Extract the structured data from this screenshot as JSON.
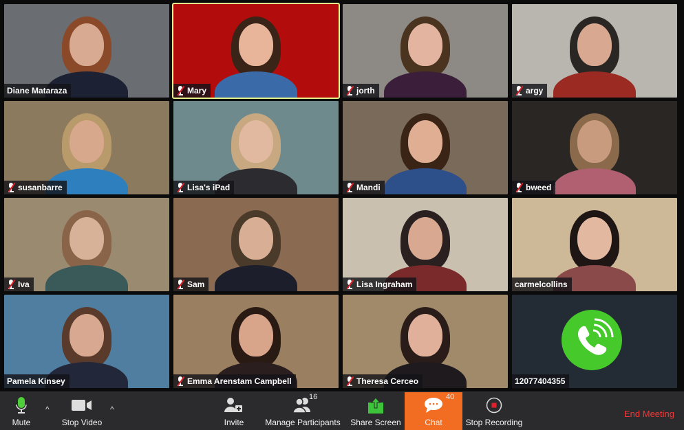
{
  "participants": [
    {
      "name": "Diane Mataraza",
      "muted": false,
      "active": false,
      "bg": "#6a6e72",
      "skin": "#d8aa92",
      "hair": "#8a4a2a",
      "shirt": "#1c2233"
    },
    {
      "name": "Mary",
      "muted": true,
      "active": true,
      "bg": "#b30c0c",
      "skin": "#e8b49a",
      "hair": "#3a2418",
      "shirt": "#3a6aa8"
    },
    {
      "name": "jorth",
      "muted": true,
      "active": false,
      "bg": "#8d8a85",
      "skin": "#e3b4a0",
      "hair": "#4a3420",
      "shirt": "#3b1f3a"
    },
    {
      "name": "argy",
      "muted": true,
      "active": false,
      "bg": "#b8b6ae",
      "skin": "#d8a890",
      "hair": "#2a2624",
      "shirt": "#9b2b22"
    },
    {
      "name": "susanbarre",
      "muted": true,
      "active": false,
      "bg": "#8c7a5e",
      "skin": "#d8a88c",
      "hair": "#b99a6a",
      "shirt": "#2e7fbd"
    },
    {
      "name": "Lisa's iPad",
      "muted": true,
      "active": false,
      "bg": "#6f8a8c",
      "skin": "#e1b8a0",
      "hair": "#c8a880",
      "shirt": "#2b2b30"
    },
    {
      "name": "Mandi",
      "muted": true,
      "active": false,
      "bg": "#7a6a5a",
      "skin": "#e0ae92",
      "hair": "#3a2416",
      "shirt": "#2d4f8a"
    },
    {
      "name": "bweed",
      "muted": true,
      "active": false,
      "bg": "#2a2624",
      "skin": "#c89a7e",
      "hair": "#8a6a4a",
      "shirt": "#b06070"
    },
    {
      "name": "Iva",
      "muted": true,
      "active": false,
      "bg": "#9a8a70",
      "skin": "#d8b298",
      "hair": "#8a6448",
      "shirt": "#3a5a5a"
    },
    {
      "name": "Sam",
      "muted": true,
      "active": false,
      "bg": "#8a6a50",
      "skin": "#d8ae94",
      "hair": "#4a3a2a",
      "shirt": "#1c1e2c"
    },
    {
      "name": "Lisa Ingraham",
      "muted": true,
      "active": false,
      "bg": "#c9c0b0",
      "skin": "#d8a890",
      "hair": "#2a2020",
      "shirt": "#7a2a2a"
    },
    {
      "name": "carmelcollins",
      "muted": false,
      "active": false,
      "bg": "#cdb898",
      "skin": "#e2b8a0",
      "hair": "#1e1614",
      "shirt": "#8a4a4a"
    },
    {
      "name": "Pamela Kinsey",
      "muted": false,
      "active": false,
      "bg": "#4f7ea0",
      "skin": "#d8a890",
      "hair": "#5a3a2a",
      "shirt": "#22283a"
    },
    {
      "name": "Emma Arenstam Campbell",
      "muted": true,
      "active": false,
      "bg": "#9a8060",
      "skin": "#d8a48a",
      "hair": "#2a1a14",
      "shirt": "#2a1e1e"
    },
    {
      "name": "Theresa Cerceo",
      "muted": true,
      "active": false,
      "bg": "#a08a6a",
      "skin": "#e0b09a",
      "hair": "#2a1c18",
      "shirt": "#1e1a1e"
    }
  ],
  "phone_participant": {
    "name": "12077404355",
    "icon": "phone-call-icon",
    "color": "#46c92b"
  },
  "toolbar": {
    "mute": "Mute",
    "stop_video": "Stop Video",
    "invite": "Invite",
    "manage_participants": "Manage Participants",
    "participant_count": "16",
    "share_screen": "Share Screen",
    "chat": "Chat",
    "chat_count": "40",
    "stop_recording": "Stop Recording",
    "end_meeting": "End Meeting",
    "caret": "^"
  },
  "colors": {
    "chat_accent": "#f26d21",
    "end_meeting": "#ef3b3b",
    "active_border": "#e6f08a",
    "share_green": "#3dc43a"
  }
}
